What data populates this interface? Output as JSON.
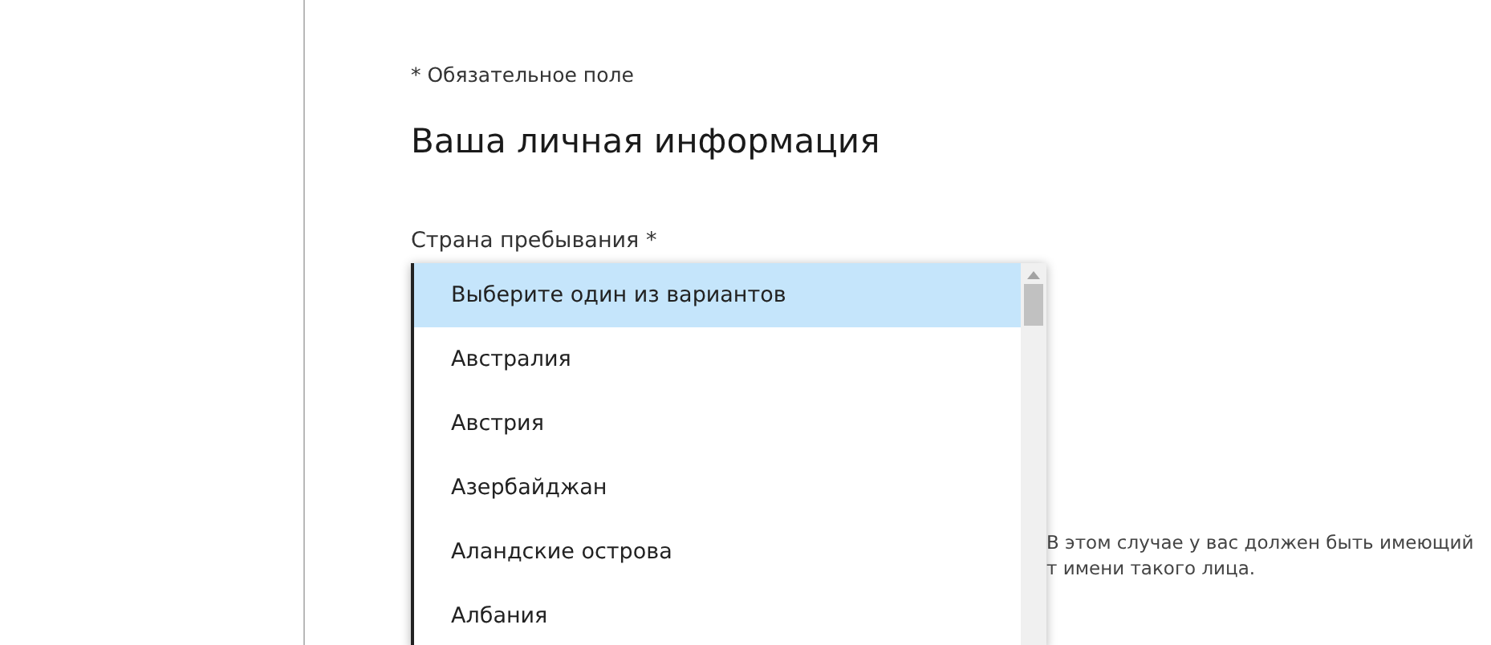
{
  "required_note": "* Обязательное поле",
  "heading": "Ваша личная информация",
  "country_field": {
    "label": "Страна пребывания *",
    "options": [
      {
        "label": "Выберите один из вариантов",
        "selected": true
      },
      {
        "label": "Австралия",
        "selected": false
      },
      {
        "label": "Австрия",
        "selected": false
      },
      {
        "label": "Азербайджан",
        "selected": false
      },
      {
        "label": "Аландские острова",
        "selected": false
      },
      {
        "label": "Албания",
        "selected": false
      }
    ]
  },
  "hint_lines": [
    "В этом случае у вас должен быть имеющий",
    "т имени такого лица."
  ]
}
